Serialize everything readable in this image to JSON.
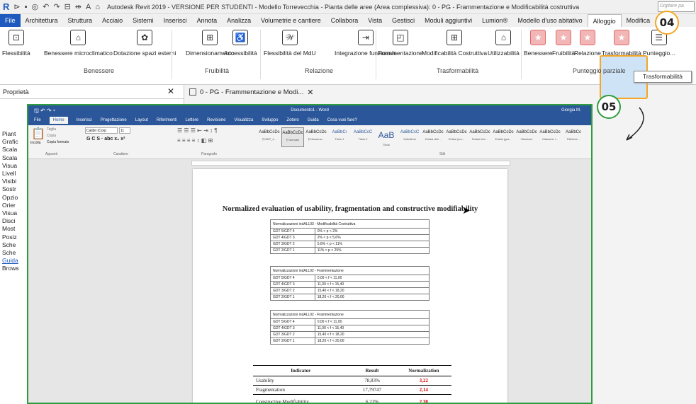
{
  "revit": {
    "title": "Autodesk Revit 2019 - VERSIONE PER STUDENTI - Modello Torrevecchia - Pianta delle aree (Area complessiva): 0 - PG - Frammentazione e Modificabilità costruttiva",
    "search_placeholder": "Digitare pa",
    "tabs": [
      "File",
      "Architettura",
      "Struttura",
      "Acciaio",
      "Sistemi",
      "Inserisci",
      "Annota",
      "Analizza",
      "Volumetrie e cantiere",
      "Collabora",
      "Vista",
      "Gestisci",
      "Moduli aggiuntivi",
      "Lumion®",
      "Modello d'uso abitativo",
      "Alloggio",
      "Modifica"
    ],
    "ribbon_buttons": [
      "Flessibilità",
      "Benessere microclimatico",
      "Dotazione spazi esterni",
      "Dimensionamento",
      "Accessibilità",
      "Flessibilità del MdU",
      "Integrazione funzionale",
      "Frammentazione",
      "Modificabilità Costruttiva",
      "Utilizzabilità",
      "Benessere",
      "Fruibilità",
      "Relazione",
      "Trasformabilità",
      "Punteggio..."
    ],
    "panels": [
      "Benessere",
      "Fruibilità",
      "Relazione",
      "Trasformabilità",
      "Punteggio parziale"
    ],
    "tooltip": "Trasformabilità",
    "properties_label": "Proprietà",
    "view_tab": "0 - PG - Frammentazione e Modi...",
    "side_items": [
      "Piant",
      "Grafic",
      "Scala",
      "Scala",
      "Visua",
      "Livell",
      "Visibi",
      "Sostr",
      "Opzio",
      "Orier",
      "Visua",
      "Disci",
      "Most",
      "Posiz",
      "Sche",
      "Sche",
      "Guida",
      "Brows"
    ]
  },
  "badges": {
    "step4": "04",
    "step5": "05"
  },
  "word": {
    "title": "Documento1 - Word",
    "user": "Giorgia M.",
    "tabs": [
      "File",
      "Home",
      "Inserisci",
      "Progettazione",
      "Layout",
      "Riferimenti",
      "Lettere",
      "Revisione",
      "Visualizza",
      "Sviluppo",
      "Zotero",
      "Guida",
      "Cosa vuoi fare?"
    ],
    "clipboard": {
      "cut": "Taglia",
      "copy": "Copia",
      "paste": "Incolla",
      "format": "Copia formato",
      "group": "Appunti"
    },
    "font": {
      "name": "Calibri (Corp",
      "size": "11",
      "group": "Carattere"
    },
    "paragraph_group": "Paragrafo",
    "styles_group": "Stili",
    "styles": [
      {
        "preview": "AaBbCcDc",
        "name": "¶ MDP_4..."
      },
      {
        "preview": "AaBbCcDc",
        "name": "¶ Normale"
      },
      {
        "preview": "AaBbCcDc",
        "name": "¶ Nessuna..."
      },
      {
        "preview": "AaBbCı",
        "name": "Titolo 1"
      },
      {
        "preview": "AaBbCcC",
        "name": "Titolo 2"
      },
      {
        "preview": "AaB",
        "name": "Titolo"
      },
      {
        "preview": "AaBbCcC",
        "name": "Sottotitolo"
      },
      {
        "preview": "AaBbCcDc",
        "name": "Enfasi deli..."
      },
      {
        "preview": "AaBbCcDc",
        "name": "Enfasi (cor..."
      },
      {
        "preview": "AaBbCcDc",
        "name": "Enfasi inte..."
      },
      {
        "preview": "AaBbCcDc",
        "name": "Enfasi (gra..."
      },
      {
        "preview": "AaBbCcDc",
        "name": "Citazione"
      },
      {
        "preview": "AaBbCcDc",
        "name": "Citazione i..."
      },
      {
        "preview": "AaBbCc",
        "name": "Riferime..."
      }
    ]
  },
  "document": {
    "heading": "Normalized evaluation of usability, fragmentation and constructive modifiability",
    "tables": [
      {
        "title": "Normalizzazioni indALL03 - Modificabilità Costruttiva",
        "rows": [
          [
            "GDT 5/GDT 4",
            "0% < p < 2%"
          ],
          [
            "GDT 4/GDT 3",
            "2% < p < 5,6%"
          ],
          [
            "GDT 3/GDT 2",
            "5,6% < p < 11%"
          ],
          [
            "GDT 2/GDT 1",
            "11% < p < 25%"
          ]
        ]
      },
      {
        "title": "Normalizzazioni indALL02 - Frammentazione",
        "rows": [
          [
            "GDT 5/GDT 4",
            "0,00 < f < 11,00"
          ],
          [
            "GDT 4/GDT 3",
            "11,00 < f < 15,40"
          ],
          [
            "GDT 3/GDT 2",
            "15,40 < f < 18,20"
          ],
          [
            "GDT 2/GDT 1",
            "18,20 < f < 20,00"
          ]
        ]
      },
      {
        "title": "Normalizzazioni indALL02 - Frammentazione",
        "rows": [
          [
            "GDT 5/GDT 4",
            "0,00 < f < 11,00"
          ],
          [
            "GDT 4/GDT 3",
            "11,00 < f < 15,40"
          ],
          [
            "GDT 3/GDT 2",
            "15,40 < f < 18,20"
          ],
          [
            "GDT 2/GDT 1",
            "18,20 < f < 20,00"
          ]
        ]
      }
    ],
    "results": {
      "headers": [
        "Indicator",
        "Result",
        "Normalization"
      ],
      "rows": [
        {
          "indicator": "Usability",
          "result": "78,83%",
          "norm": "3,22"
        },
        {
          "indicator": "Fragmentation",
          "result": "17,79747",
          "norm": "2,14"
        },
        {
          "indicator": "Constructive Modifiability",
          "result": "6,21%",
          "norm": "2,30"
        }
      ]
    }
  },
  "colors": {
    "revit_file_tab": "#1f5bbf",
    "word_blue": "#2b579a",
    "step4_ring": "#f5a623",
    "step5_ring": "#2e9c3f",
    "norm_red": "#d20000"
  }
}
